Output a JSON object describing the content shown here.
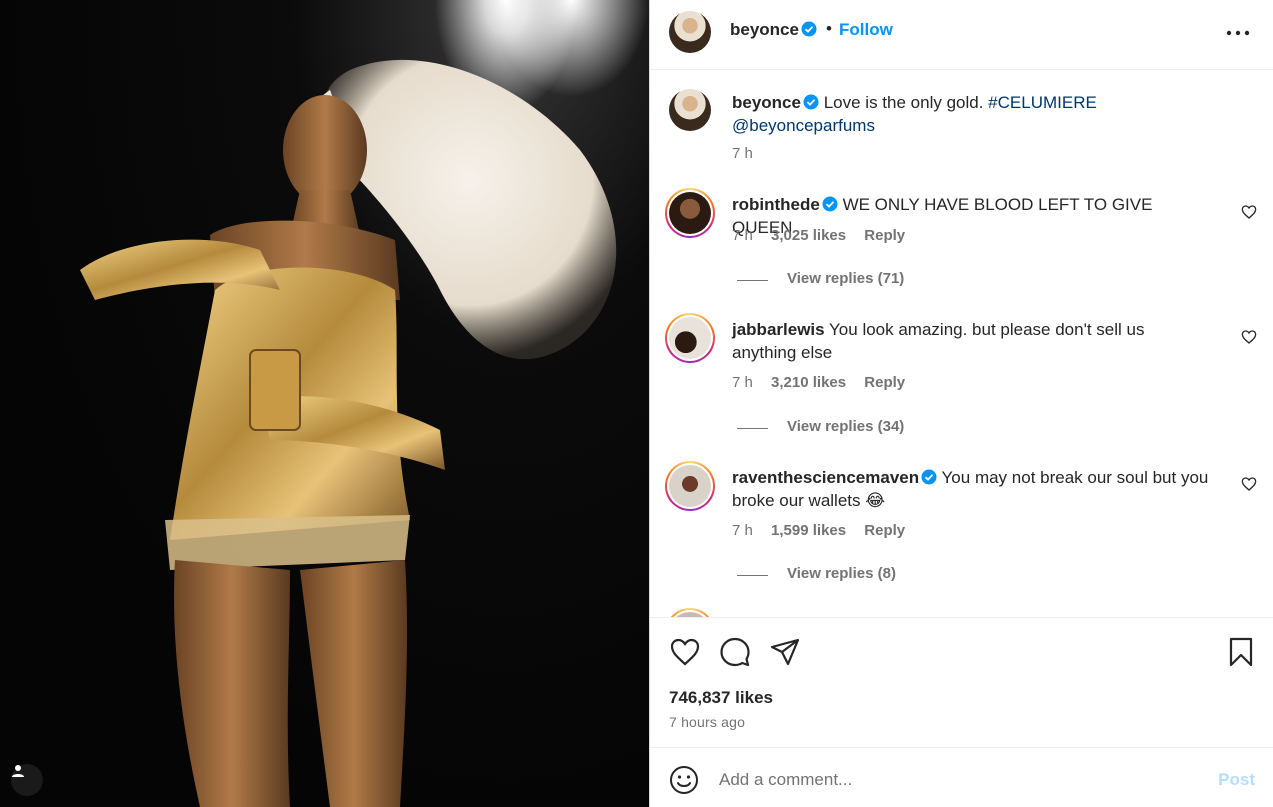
{
  "post_author": {
    "username": "beyonce",
    "follow_label": "Follow",
    "separator": "•"
  },
  "caption": {
    "username": "beyonce",
    "text": "Love is the only gold.",
    "hashtag": "#CELUMIERE",
    "mention": "@beyonceparfums",
    "time": "7 h"
  },
  "comments": [
    {
      "username": "robinthede",
      "text": "WE ONLY HAVE BLOOD LEFT TO GIVE QUEEN",
      "time": "7 h",
      "likes": "3,025 likes",
      "reply_label": "Reply",
      "view_replies": "View replies (71)"
    },
    {
      "username": "jabbarlewis",
      "text": "You look amazing. but please don't sell us anything else",
      "time": "7 h",
      "likes": "3,210 likes",
      "reply_label": "Reply",
      "view_replies": "View replies (34)"
    },
    {
      "username": "raventhesciencemaven",
      "text": "You may not break our soul but you broke our wallets 😂",
      "time": "7 h",
      "likes": "1,599 likes",
      "reply_label": "Reply",
      "view_replies": "View replies (8)"
    }
  ],
  "stats": {
    "likes": "746,837 likes",
    "posted": "7 hours ago"
  },
  "composer": {
    "placeholder": "Add a comment...",
    "post_label": "Post"
  },
  "colors": {
    "link": "#0095f6",
    "verified": "#0095f6",
    "post_disabled": "#b2dffc"
  }
}
